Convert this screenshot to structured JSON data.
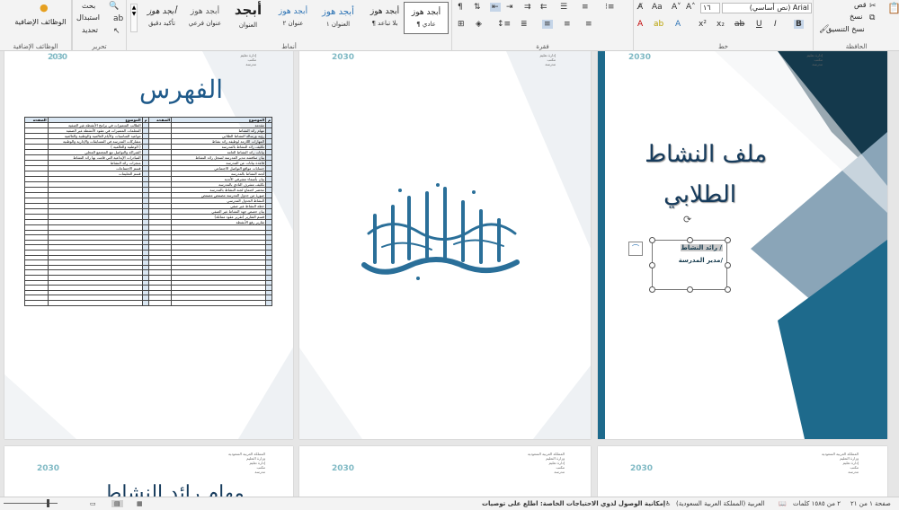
{
  "ribbon": {
    "addins_label": "الوظائف الإضافية",
    "addins_button": "الوظائف الإضافية",
    "edit_label": "تحرير",
    "find": "بحث",
    "replace": "استبدال",
    "select": "تحديد",
    "styles_label": "أنماط",
    "styles": [
      {
        "sample": "أبجد هوز",
        "name": "¶ عادي"
      },
      {
        "sample": "أبجد هوز",
        "name": "¶ بلا تباعد"
      },
      {
        "sample": "أبجد هوز",
        "name": "العنوان ١"
      },
      {
        "sample": "أبجد هوز",
        "name": "عنوان ٢"
      },
      {
        "sample": "أبجد",
        "name": "العنوان"
      },
      {
        "sample": "أبجد هوز",
        "name": "عنوان فرعي"
      },
      {
        "sample": "أبجد هوز",
        "name": "تأكيد دقيق"
      }
    ],
    "paragraph_label": "فقرة",
    "font_label": "خط",
    "font_name": "Arial (نص أساسي)",
    "font_size": "١٦",
    "clipboard_label": "الحافظة",
    "cut": "قص",
    "copy": "نسخ",
    "format_painter": "نسخ التنسيق"
  },
  "pages": {
    "cover": {
      "title_line1": "ملف النشاط",
      "title_line2": "الطلابي",
      "box_line1": "رائد النشاط /",
      "box_line2": "مدير المدرسة/",
      "header_lines": [
        "إدارة تعليم",
        "مكتب",
        "مدرسة"
      ]
    },
    "basmala": {
      "header_lines": [
        "إدارة تعليم",
        "مكتب",
        "مدرسة"
      ]
    },
    "index": {
      "title": "الفهرس",
      "header_lines": [
        "إدارة تعليم",
        "مكتب",
        "مدرسة"
      ],
      "col_headers": {
        "num": "م",
        "topic": "الموضوع",
        "page": "الصفحة"
      },
      "right_topics": [
        "مقدمه",
        "مهام رائد النشاط",
        "رؤية ورسالة النشاط الطلابي",
        "المهارات اللازمة لوظيفة رائد نشاط",
        "تكليف رائد النشاط بالمدرسة",
        "بيانات رائد النشاط العامة",
        "بيان مناقشة مدير المدرسة لسجل رائد النشاط",
        "قاعدة بيانات عن المدرسة",
        "حسابات مواقع التواصل الاجتماعي",
        "لجنة النشاط بالمدرسة",
        "بيان بأسماء مشرفي الأندية",
        "تكليف مشرف النادي بالمدرسة",
        "محضر اجتماع لجنة النشاط بالمدرسة",
        "صورة من جدول المدرسة مصمص مصمص",
        "النشاط الجدول المدرسي",
        "خطة النشاط غير صفي",
        "بيان حصص جهد النشاط غير الصفي",
        "قسم التقارير (تقرير عقود مماثلة)",
        "تقارير رفع الأنشطة"
      ],
      "left_topics": [
        "الطالب المتميزات في برامج الأنشطة غير الصفية",
        "المعلمات المتميزات في عقود الأنشطة غير الصفية",
        "مواعيد المناسبات والأيام العالمية والوطنية والعالمية",
        "مشاركات المدرسة في المسابقات والإدارية والوطنية",
        "( الوطنية والعالمية )",
        "الشراكة والتواصل مع المجتمع المحلي",
        "المبادرات الإبداعية التي قامت بها رائد النشاط",
        "منجزات رائد النشاط",
        "قسم الاجتماعات",
        "قسم التعليمات"
      ]
    },
    "bottom": {
      "gov_lines": [
        "المملكة العربية السعودية",
        "وزارة التعليم",
        "إدارة تعليم",
        "مكتب",
        "مدرسة"
      ],
      "mid_text": "مهام رائد النشاط"
    }
  },
  "status": {
    "page": "صفحة ١ من ٢١",
    "words": "٢ من ١٥٨٥ كلمات",
    "language": "العربية (المملكة العربية السعودية)",
    "accessibility": "إمكانية الوصول لذوي الاحتياجات الخاصة: اطلع على توصيات"
  },
  "colors": {
    "teal_dark": "#1e6a8c",
    "navy": "#14394c",
    "title_blue": "#163b5c",
    "steel": "#8aa5b8"
  }
}
